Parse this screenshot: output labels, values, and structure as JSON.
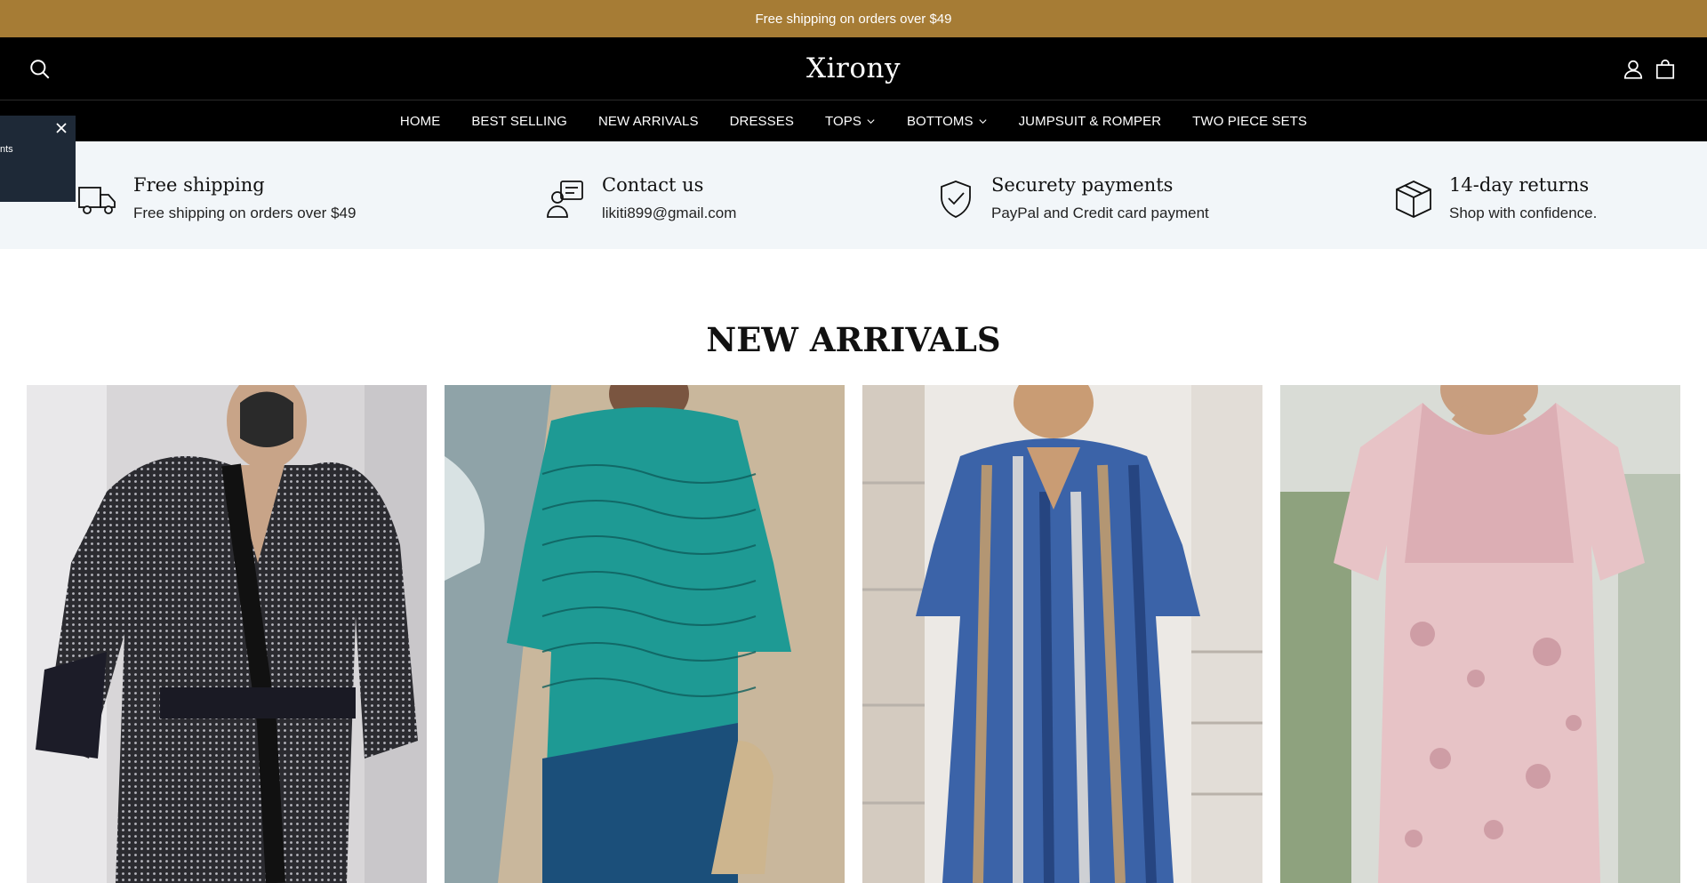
{
  "announcement": "Free shipping on orders over $49",
  "header": {
    "logo": "Xirony",
    "icons": [
      "search-icon",
      "account-icon",
      "cart-icon"
    ]
  },
  "nav": [
    {
      "label": "HOME"
    },
    {
      "label": "BEST SELLING"
    },
    {
      "label": "NEW ARRIVALS"
    },
    {
      "label": "DRESSES"
    },
    {
      "label": "TOPS",
      "dropdown": true
    },
    {
      "label": "BOTTOMS",
      "dropdown": true
    },
    {
      "label": "JUMPSUIT & ROMPER"
    },
    {
      "label": "TWO PIECE SETS"
    }
  ],
  "popup": {
    "text": "nts"
  },
  "features": [
    {
      "title": "Free shipping",
      "subtitle": "Free shipping on orders over $49",
      "icon": "truck-icon"
    },
    {
      "title": "Contact us",
      "subtitle": "likiti899@gmail.com",
      "icon": "support-icon"
    },
    {
      "title": "Securety payments",
      "subtitle": "PayPal and Credit card payment",
      "icon": "shield-check-icon"
    },
    {
      "title": "14-day returns",
      "subtitle": "Shop with confidence.",
      "icon": "box-icon"
    }
  ],
  "new_arrivals": {
    "title": "NEW ARRIVALS",
    "products": [
      {
        "image": "sequin-shirt-pants-set"
      },
      {
        "image": "teal-wave-print-dress"
      },
      {
        "image": "blue-striped-kaftan-dress"
      },
      {
        "image": "pink-lace-floral-dress"
      }
    ]
  },
  "colors": {
    "announcement_bg": "#a67c35",
    "header_bg": "#000000",
    "features_bg": "#f2f6f9",
    "popup_bg": "#1e2937"
  }
}
